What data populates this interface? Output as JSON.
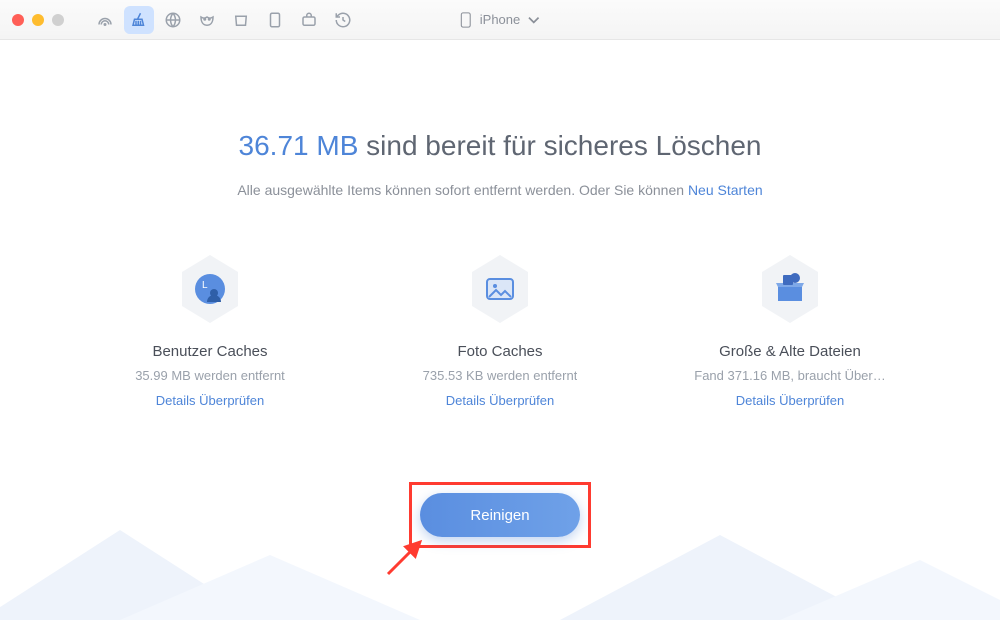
{
  "device": {
    "name": "iPhone"
  },
  "headline": {
    "size": "36.71 MB",
    "rest": "sind bereit für sicheres Löschen"
  },
  "subline": {
    "text": "Alle ausgewählte Items können sofort entfernt werden. Oder Sie können ",
    "restart": "Neu Starten"
  },
  "cards": [
    {
      "title": "Benutzer Caches",
      "sub": "35.99 MB werden entfernt",
      "link": "Details Überprüfen"
    },
    {
      "title": "Foto Caches",
      "sub": "735.53 KB werden entfernt",
      "link": "Details Überprüfen"
    },
    {
      "title": "Große & Alte Dateien",
      "sub": "Fand 371.16 MB, braucht Über…",
      "link": "Details Überprüfen"
    }
  ],
  "clean": {
    "label": "Reinigen"
  }
}
